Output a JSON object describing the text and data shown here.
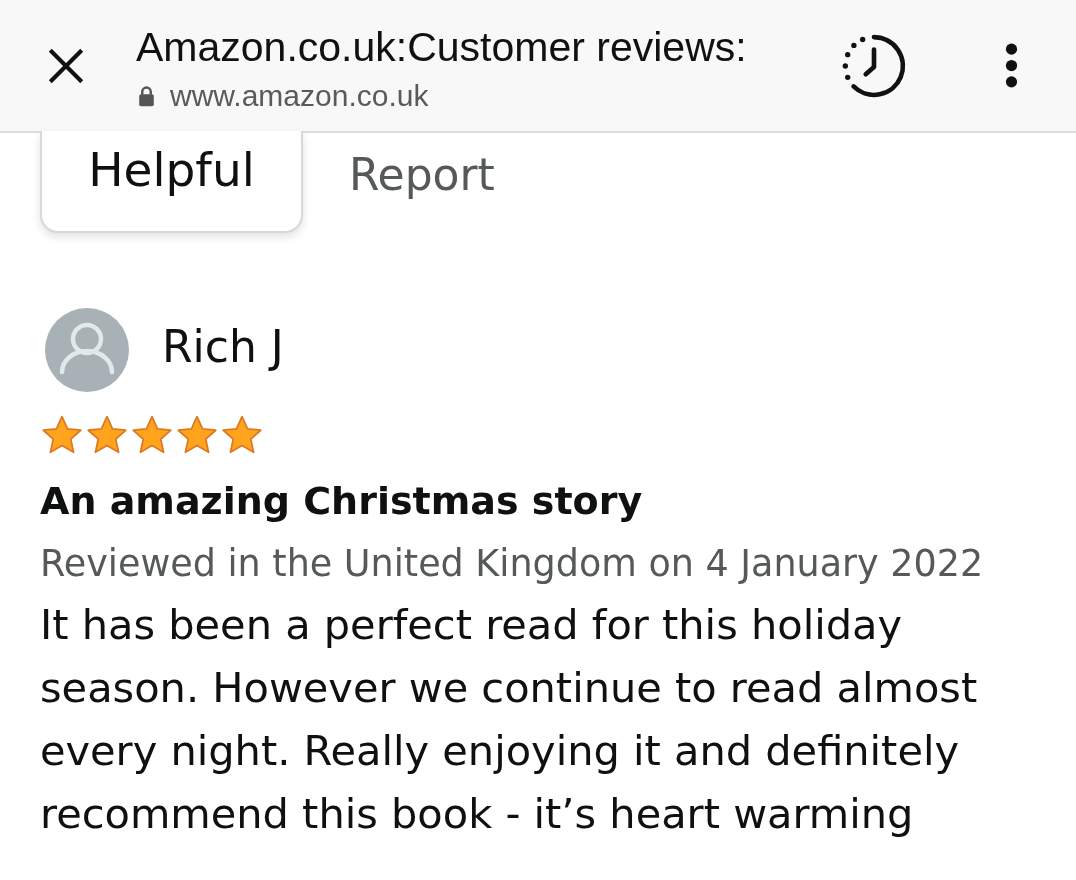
{
  "browser_bar": {
    "title": "Amazon.co.uk:Customer reviews:",
    "url": "www.amazon.co.uk"
  },
  "previous_review_actions": {
    "helpful_button": "Helpful",
    "report_link": "Report"
  },
  "review": {
    "reviewer": "Rich J",
    "stars": 5,
    "title": "An amazing Christmas story",
    "meta": "Reviewed in the United Kingdom on 4 January 2022",
    "body": "It has been a perfect read for this holiday season. However we continue to read almost every night. Really enjoying it and definitely recommend this book - it’s heart warming"
  }
}
